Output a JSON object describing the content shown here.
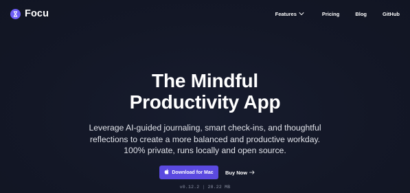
{
  "brand": {
    "name": "Focu",
    "logo_icon": "hourglass-icon",
    "logo_color": "#6d5df6"
  },
  "nav": {
    "features_label": "Features",
    "features_icon": "chevron-down-icon",
    "pricing_label": "Pricing",
    "blog_label": "Blog",
    "github_label": "GitHub"
  },
  "hero": {
    "title_line1": "The Mindful",
    "title_line2": "Productivity App",
    "desc_line1": "Leverage AI-guided journaling, smart check-ins, and thoughtful",
    "desc_line2": "reflections to create a more balanced and productive workday.",
    "desc_line3": "100% private, runs locally and open source."
  },
  "cta": {
    "download_label": "Download for Mac",
    "download_icon": "apple-icon",
    "download_color": "#5b4ae0",
    "buy_label": "Buy Now",
    "buy_icon": "arrow-right-icon"
  },
  "release": {
    "version": "v0.12.2",
    "separator": "|",
    "size": "28.22 MB"
  },
  "theme": {
    "background": "#131726",
    "accent": "#6d5df6"
  }
}
